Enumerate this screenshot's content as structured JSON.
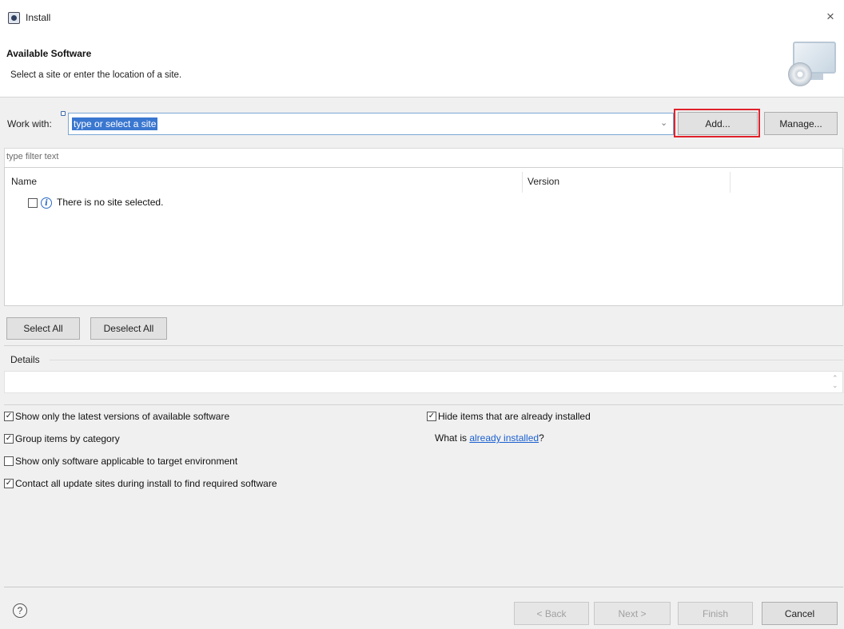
{
  "window": {
    "title": "Install",
    "close_glyph": "×"
  },
  "banner": {
    "title": "Available Software",
    "description": "Select a site or enter the location of a site.",
    "image_icon": "computer-disc-icon"
  },
  "work_with": {
    "label": "Work with:",
    "value": "type or select a site",
    "dropdown_glyph": "⌄",
    "add_label": "Add...",
    "manage_label": "Manage..."
  },
  "filter": {
    "placeholder": "type filter text"
  },
  "tree": {
    "columns": [
      "Name",
      "Version"
    ],
    "rows": [
      {
        "checked": false,
        "icon": "info-icon",
        "text": "There is no site selected."
      }
    ]
  },
  "selection_buttons": {
    "select_all": "Select All",
    "deselect_all": "Deselect All"
  },
  "details": {
    "label": "Details",
    "value": ""
  },
  "options": {
    "latest_versions": {
      "label": "Show only the latest versions of available software",
      "checked": true
    },
    "group_by_category": {
      "label": "Group items by category",
      "checked": true
    },
    "target_env": {
      "label": "Show only software applicable to target environment",
      "checked": false
    },
    "contact_sites": {
      "label": "Contact all update sites during install to find required software",
      "checked": true
    },
    "hide_installed": {
      "label": "Hide items that are already installed",
      "checked": true
    },
    "what_is_prefix": "What is ",
    "what_is_link": "already installed",
    "what_is_suffix": "?"
  },
  "footer": {
    "help_glyph": "?",
    "back": "< Back",
    "next": "Next >",
    "finish": "Finish",
    "cancel": "Cancel",
    "back_enabled": false,
    "next_enabled": false,
    "finish_enabled": false
  },
  "colors": {
    "selection_blue": "#3a77d0",
    "highlight_red": "#e0222b",
    "link_blue": "#1a5fd0"
  },
  "checkmark_glyph": "✓"
}
